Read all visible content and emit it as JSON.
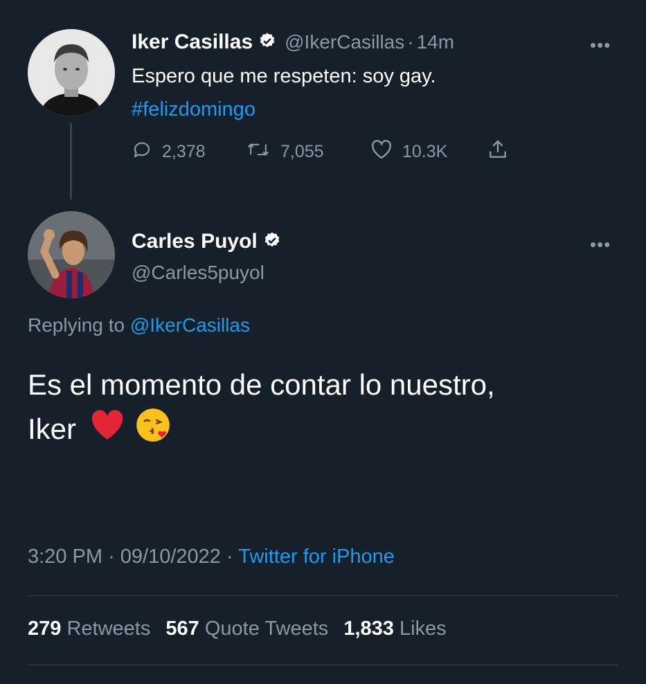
{
  "tweet1": {
    "name": "Iker Casillas",
    "handle": "@IkerCasillas",
    "separator": "·",
    "time": "14m",
    "text": "Espero que me respeten: soy gay.",
    "hashtag": "#felizdomingo",
    "reply_count": "2,378",
    "retweet_count": "7,055",
    "like_count": "10.3K"
  },
  "tweet2": {
    "name": "Carles Puyol",
    "handle": "@Carles5puyol",
    "replying_prefix": "Replying to",
    "replying_handle": "@IkerCasillas",
    "text_line1": "Es el momento de contar lo nuestro,",
    "text_line2": "Iker",
    "emoji_heart": "❤️",
    "emoji_kiss": "😘",
    "time": "3:20 PM",
    "date": "09/10/2022",
    "source": "Twitter for iPhone",
    "dot": "·"
  },
  "stats": {
    "retweets_count": "279",
    "retweets_label": "Retweets",
    "quotes_count": "567",
    "quotes_label": "Quote Tweets",
    "likes_count": "1,833",
    "likes_label": "Likes"
  },
  "more_glyph": "•••",
  "colors": {
    "background": "#15202b",
    "text": "#ffffff",
    "muted": "#8b98a5",
    "accent": "#1d9bf0",
    "divider": "#38444d"
  },
  "icons": [
    "verified-badge-icon",
    "more-icon",
    "reply-icon",
    "retweet-icon",
    "like-icon",
    "share-icon"
  ]
}
